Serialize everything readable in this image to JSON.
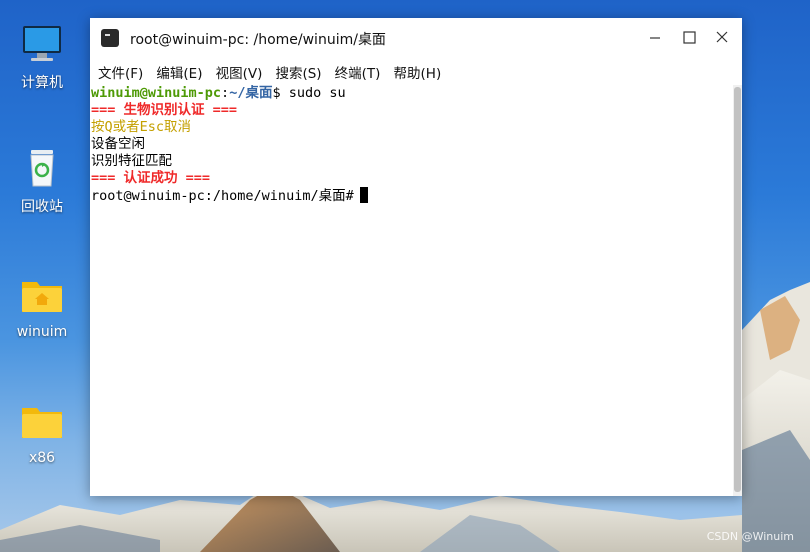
{
  "desktop": {
    "icons": [
      {
        "label": "计算机",
        "icon": "computer-icon"
      },
      {
        "label": "回收站",
        "icon": "recycle-bin-icon"
      },
      {
        "label": "winuim",
        "icon": "home-folder-icon"
      },
      {
        "label": "x86",
        "icon": "folder-icon"
      }
    ],
    "watermark": "CSDN @Winuim"
  },
  "window": {
    "title": "root@winuim-pc: /home/winuim/桌面",
    "icon": "terminal-icon",
    "controls": [
      "minimize-icon",
      "maximize-icon",
      "close-icon"
    ],
    "menu": [
      "文件(F)",
      "编辑(E)",
      "视图(V)",
      "搜索(S)",
      "终端(T)",
      "帮助(H)"
    ]
  },
  "terminal": {
    "prompt_user": "winuim@winuim-pc",
    "prompt_colon": ":",
    "prompt_path": "~/桌面",
    "prompt_symbol": "$ ",
    "command": "sudo su",
    "lines": [
      "=== 生物识别认证 ===",
      "按Q或者Esc取消",
      "设备空闲",
      "识别特征匹配",
      "=== 认证成功 ==="
    ],
    "root_prompt": "root@winuim-pc:/home/winuim/桌面#",
    "colors": {
      "user": "#4e9a06",
      "path": "#3465a4",
      "alert": "#ef2929",
      "hint": "#c4a000"
    }
  }
}
